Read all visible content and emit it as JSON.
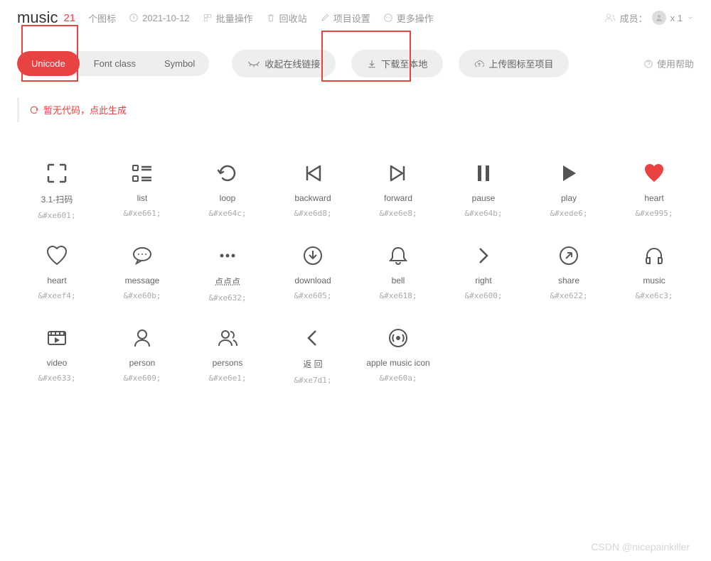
{
  "header": {
    "title": "music",
    "count": "21",
    "count_label": "个图标",
    "date": "2021-10-12",
    "batch": "批量操作",
    "trash": "回收站",
    "settings": "项目设置",
    "more": "更多操作",
    "members_label": "成员：",
    "members_count": "x 1"
  },
  "tabs": {
    "unicode": "Unicode",
    "fontclass": "Font class",
    "symbol": "Symbol"
  },
  "actions": {
    "collapse": "收起在线链接",
    "download": "下载至本地",
    "upload": "上传图标至项目",
    "help": "使用帮助"
  },
  "codebar": {
    "text": "暂无代码，点此生成"
  },
  "icons": [
    {
      "name": "3.1-扫码",
      "code": "&#xe601;",
      "svg": "scan"
    },
    {
      "name": "list",
      "code": "&#xe661;",
      "svg": "list"
    },
    {
      "name": "loop",
      "code": "&#xe64c;",
      "svg": "loop"
    },
    {
      "name": "backward",
      "code": "&#xe6d8;",
      "svg": "backward"
    },
    {
      "name": "forward",
      "code": "&#xe6e8;",
      "svg": "forward"
    },
    {
      "name": "pause",
      "code": "&#xe64b;",
      "svg": "pause"
    },
    {
      "name": "play",
      "code": "&#xede6;",
      "svg": "play"
    },
    {
      "name": "heart",
      "code": "&#xe995;",
      "svg": "heart-fill"
    },
    {
      "name": "heart",
      "code": "&#xeef4;",
      "svg": "heart"
    },
    {
      "name": "message",
      "code": "&#xe60b;",
      "svg": "message"
    },
    {
      "name": "点点点",
      "code": "&#xe632;",
      "svg": "dots"
    },
    {
      "name": "download",
      "code": "&#xe605;",
      "svg": "download"
    },
    {
      "name": "bell",
      "code": "&#xe618;",
      "svg": "bell"
    },
    {
      "name": "right",
      "code": "&#xe600;",
      "svg": "right"
    },
    {
      "name": "share",
      "code": "&#xe622;",
      "svg": "share"
    },
    {
      "name": "music",
      "code": "&#xe6c3;",
      "svg": "headphone"
    },
    {
      "name": "video",
      "code": "&#xe633;",
      "svg": "video"
    },
    {
      "name": "person",
      "code": "&#xe609;",
      "svg": "person"
    },
    {
      "name": "persons",
      "code": "&#xe6e1;",
      "svg": "persons"
    },
    {
      "name": "返 回",
      "code": "&#xe7d1;",
      "svg": "back"
    },
    {
      "name": "apple music icon",
      "code": "&#xe60a;",
      "svg": "radio"
    }
  ],
  "watermark": "CSDN @nicepainkiller"
}
